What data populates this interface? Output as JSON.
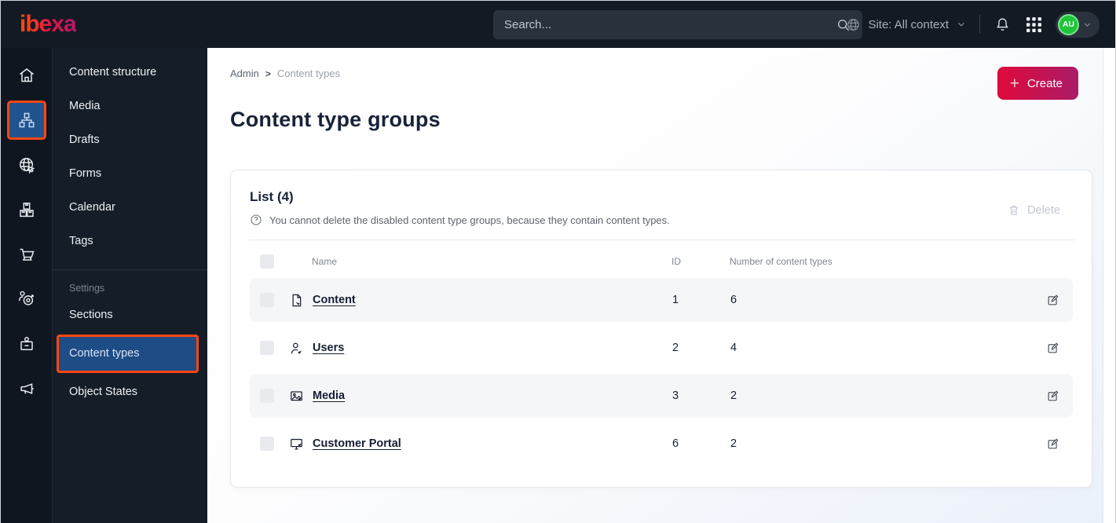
{
  "topbar": {
    "logo": "ibexa",
    "search_placeholder": "Search...",
    "site_context": "Site: All context",
    "avatar_initials": "AU"
  },
  "sidebar": {
    "rail_items": [
      {
        "name": "dashboard",
        "icon": "home-icon",
        "active": false
      },
      {
        "name": "content",
        "icon": "sitemap-icon",
        "active": true
      },
      {
        "name": "site",
        "icon": "globe-cursor-icon",
        "active": false
      },
      {
        "name": "product-catalog",
        "icon": "boxes-icon",
        "active": false
      },
      {
        "name": "commerce",
        "icon": "cart-icon",
        "active": false
      },
      {
        "name": "customers",
        "icon": "person-target-icon",
        "active": false
      },
      {
        "name": "admin",
        "icon": "badge-icon",
        "active": false
      },
      {
        "name": "marketing",
        "icon": "megaphone-icon",
        "active": false
      }
    ],
    "menu": {
      "items": [
        "Content structure",
        "Media",
        "Drafts",
        "Forms",
        "Calendar",
        "Tags"
      ],
      "settings_label": "Settings",
      "settings_items": [
        "Sections",
        "Content types",
        "Object States"
      ],
      "active_item": "Content types"
    }
  },
  "main": {
    "breadcrumb": {
      "parent": "Admin",
      "current": "Content types"
    },
    "create_label": "Create",
    "title": "Content type groups",
    "card": {
      "list_title": "List (4)",
      "info_text": "You cannot delete the disabled content type groups, because they contain content types.",
      "delete_label": "Delete",
      "table": {
        "columns": {
          "name": "Name",
          "id": "ID",
          "count": "Number of content types"
        },
        "rows": [
          {
            "name": "Content",
            "icon": "file-icon",
            "id": "1",
            "count": "6"
          },
          {
            "name": "Users",
            "icon": "user-icon",
            "id": "2",
            "count": "4"
          },
          {
            "name": "Media",
            "icon": "image-icon",
            "id": "3",
            "count": "2"
          },
          {
            "name": "Customer Portal",
            "icon": "monitor-icon",
            "id": "6",
            "count": "2"
          }
        ]
      }
    }
  },
  "colors": {
    "accent_orange": "#ff4713",
    "active_blue": "#1e4c85",
    "brand_gradient_start": "#e00a3c",
    "brand_gradient_end": "#aa1b67",
    "avatar_green": "#1fc43a",
    "topbar_dark": "#131a23"
  }
}
